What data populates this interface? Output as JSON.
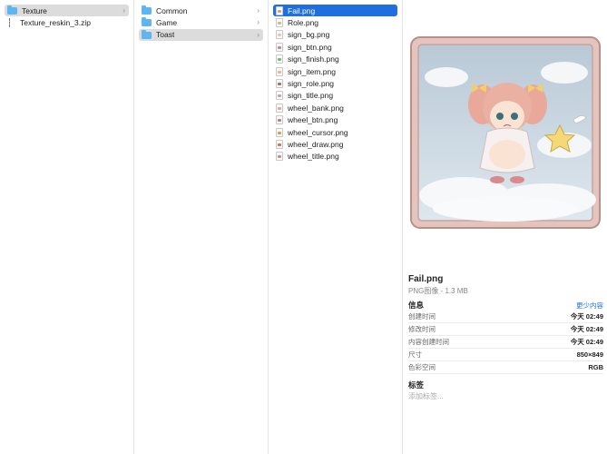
{
  "column1": [
    {
      "label": "Texture",
      "kind": "folder",
      "selected": "grey",
      "chevron": true
    },
    {
      "label": "Texture_reskin_3.zip",
      "kind": "zip"
    }
  ],
  "column2": [
    {
      "label": "Common",
      "kind": "folder",
      "chevron": true
    },
    {
      "label": "Game",
      "kind": "folder",
      "chevron": true
    },
    {
      "label": "Toast",
      "kind": "folder",
      "selected": "grey",
      "chevron": true
    }
  ],
  "column3": [
    {
      "label": "Fail.png",
      "selected": "blue",
      "color": "#d9a08a"
    },
    {
      "label": "Role.png",
      "color": "#c9b89a"
    },
    {
      "label": "sign_bg.png",
      "color": "#e6c8b0"
    },
    {
      "label": "sign_btn.png",
      "color": "#d98080"
    },
    {
      "label": "sign_finish.png",
      "color": "#6fbf73"
    },
    {
      "label": "sign_item.png",
      "color": "#e8b890"
    },
    {
      "label": "sign_role.png",
      "color": "#b07050"
    },
    {
      "label": "sign_title.png",
      "color": "#cda0a0"
    },
    {
      "label": "wheel_bank.png",
      "color": "#d0b0a0"
    },
    {
      "label": "wheel_btn.png",
      "color": "#c08080"
    },
    {
      "label": "wheel_cursor.png",
      "color": "#e0a040"
    },
    {
      "label": "wheel_draw.png",
      "color": "#d87050"
    },
    {
      "label": "wheel_title.png",
      "color": "#c09090"
    }
  ],
  "preview": {
    "name": "Fail.png",
    "subtitle": "PNG图像 - 1.3 MB",
    "info_heading": "信息",
    "more_link": "更少内容",
    "info": [
      {
        "key": "创建时间",
        "value": "今天 02:49"
      },
      {
        "key": "修改时间",
        "value": "今天 02:49"
      },
      {
        "key": "内容创建时间",
        "value": "今天 02:49"
      },
      {
        "key": "尺寸",
        "value": "850×849"
      },
      {
        "key": "色彩空间",
        "value": "RGB"
      }
    ],
    "tags_heading": "标签",
    "tags_placeholder": "添加标签..."
  },
  "colors": {
    "selection_blue": "#1f6fe0",
    "selection_grey": "#dcdcdc",
    "folder": "#5fb4f2"
  }
}
